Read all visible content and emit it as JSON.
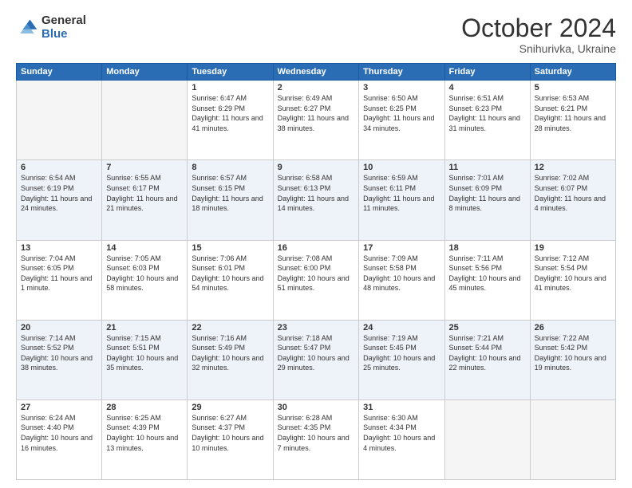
{
  "logo": {
    "general": "General",
    "blue": "Blue"
  },
  "header": {
    "month": "October 2024",
    "location": "Snihurivka, Ukraine"
  },
  "days_of_week": [
    "Sunday",
    "Monday",
    "Tuesday",
    "Wednesday",
    "Thursday",
    "Friday",
    "Saturday"
  ],
  "weeks": [
    [
      {
        "day": "",
        "info": ""
      },
      {
        "day": "",
        "info": ""
      },
      {
        "day": "1",
        "info": "Sunrise: 6:47 AM\nSunset: 6:29 PM\nDaylight: 11 hours and 41 minutes."
      },
      {
        "day": "2",
        "info": "Sunrise: 6:49 AM\nSunset: 6:27 PM\nDaylight: 11 hours and 38 minutes."
      },
      {
        "day": "3",
        "info": "Sunrise: 6:50 AM\nSunset: 6:25 PM\nDaylight: 11 hours and 34 minutes."
      },
      {
        "day": "4",
        "info": "Sunrise: 6:51 AM\nSunset: 6:23 PM\nDaylight: 11 hours and 31 minutes."
      },
      {
        "day": "5",
        "info": "Sunrise: 6:53 AM\nSunset: 6:21 PM\nDaylight: 11 hours and 28 minutes."
      }
    ],
    [
      {
        "day": "6",
        "info": "Sunrise: 6:54 AM\nSunset: 6:19 PM\nDaylight: 11 hours and 24 minutes."
      },
      {
        "day": "7",
        "info": "Sunrise: 6:55 AM\nSunset: 6:17 PM\nDaylight: 11 hours and 21 minutes."
      },
      {
        "day": "8",
        "info": "Sunrise: 6:57 AM\nSunset: 6:15 PM\nDaylight: 11 hours and 18 minutes."
      },
      {
        "day": "9",
        "info": "Sunrise: 6:58 AM\nSunset: 6:13 PM\nDaylight: 11 hours and 14 minutes."
      },
      {
        "day": "10",
        "info": "Sunrise: 6:59 AM\nSunset: 6:11 PM\nDaylight: 11 hours and 11 minutes."
      },
      {
        "day": "11",
        "info": "Sunrise: 7:01 AM\nSunset: 6:09 PM\nDaylight: 11 hours and 8 minutes."
      },
      {
        "day": "12",
        "info": "Sunrise: 7:02 AM\nSunset: 6:07 PM\nDaylight: 11 hours and 4 minutes."
      }
    ],
    [
      {
        "day": "13",
        "info": "Sunrise: 7:04 AM\nSunset: 6:05 PM\nDaylight: 11 hours and 1 minute."
      },
      {
        "day": "14",
        "info": "Sunrise: 7:05 AM\nSunset: 6:03 PM\nDaylight: 10 hours and 58 minutes."
      },
      {
        "day": "15",
        "info": "Sunrise: 7:06 AM\nSunset: 6:01 PM\nDaylight: 10 hours and 54 minutes."
      },
      {
        "day": "16",
        "info": "Sunrise: 7:08 AM\nSunset: 6:00 PM\nDaylight: 10 hours and 51 minutes."
      },
      {
        "day": "17",
        "info": "Sunrise: 7:09 AM\nSunset: 5:58 PM\nDaylight: 10 hours and 48 minutes."
      },
      {
        "day": "18",
        "info": "Sunrise: 7:11 AM\nSunset: 5:56 PM\nDaylight: 10 hours and 45 minutes."
      },
      {
        "day": "19",
        "info": "Sunrise: 7:12 AM\nSunset: 5:54 PM\nDaylight: 10 hours and 41 minutes."
      }
    ],
    [
      {
        "day": "20",
        "info": "Sunrise: 7:14 AM\nSunset: 5:52 PM\nDaylight: 10 hours and 38 minutes."
      },
      {
        "day": "21",
        "info": "Sunrise: 7:15 AM\nSunset: 5:51 PM\nDaylight: 10 hours and 35 minutes."
      },
      {
        "day": "22",
        "info": "Sunrise: 7:16 AM\nSunset: 5:49 PM\nDaylight: 10 hours and 32 minutes."
      },
      {
        "day": "23",
        "info": "Sunrise: 7:18 AM\nSunset: 5:47 PM\nDaylight: 10 hours and 29 minutes."
      },
      {
        "day": "24",
        "info": "Sunrise: 7:19 AM\nSunset: 5:45 PM\nDaylight: 10 hours and 25 minutes."
      },
      {
        "day": "25",
        "info": "Sunrise: 7:21 AM\nSunset: 5:44 PM\nDaylight: 10 hours and 22 minutes."
      },
      {
        "day": "26",
        "info": "Sunrise: 7:22 AM\nSunset: 5:42 PM\nDaylight: 10 hours and 19 minutes."
      }
    ],
    [
      {
        "day": "27",
        "info": "Sunrise: 6:24 AM\nSunset: 4:40 PM\nDaylight: 10 hours and 16 minutes."
      },
      {
        "day": "28",
        "info": "Sunrise: 6:25 AM\nSunset: 4:39 PM\nDaylight: 10 hours and 13 minutes."
      },
      {
        "day": "29",
        "info": "Sunrise: 6:27 AM\nSunset: 4:37 PM\nDaylight: 10 hours and 10 minutes."
      },
      {
        "day": "30",
        "info": "Sunrise: 6:28 AM\nSunset: 4:35 PM\nDaylight: 10 hours and 7 minutes."
      },
      {
        "day": "31",
        "info": "Sunrise: 6:30 AM\nSunset: 4:34 PM\nDaylight: 10 hours and 4 minutes."
      },
      {
        "day": "",
        "info": ""
      },
      {
        "day": "",
        "info": ""
      }
    ]
  ]
}
